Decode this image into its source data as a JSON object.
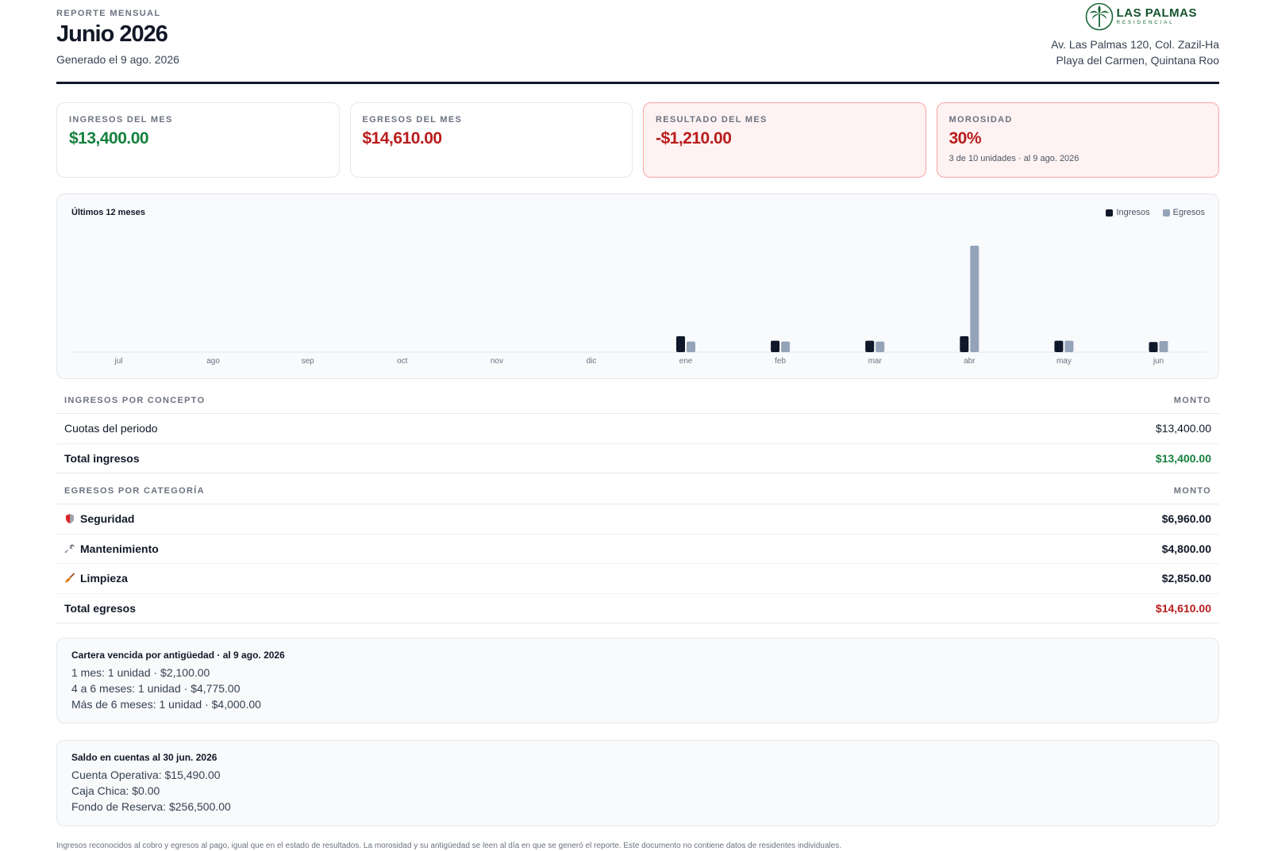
{
  "header": {
    "kicker": "REPORTE MENSUAL",
    "title": "Junio 2026",
    "subtitle": "Generado el 9 ago. 2026",
    "brand_name": "LAS PALMAS",
    "brand_sub": "RESIDENCIAL",
    "address_line1": "Av. Las Palmas 120, Col. Zazil-Ha",
    "address_line2": "Playa del Carmen, Quintana Roo"
  },
  "kpis": [
    {
      "label": "INGRESOS DEL MES",
      "value": "$13,400.00",
      "tone": "green"
    },
    {
      "label": "EGRESOS DEL MES",
      "value": "$14,610.00",
      "tone": "red"
    },
    {
      "label": "RESULTADO DEL MES",
      "value": "-$1,210.00",
      "tone": "red"
    },
    {
      "label": "MOROSIDAD",
      "value": "30%",
      "tone": "red",
      "note": "3 de 10 unidades · al 9 ago. 2026"
    }
  ],
  "chart": {
    "title": "Últimos 12 meses",
    "legend_income": "Ingresos",
    "legend_expense": "Egresos",
    "colors": {
      "income": "#0f172a",
      "expense": "#94a3b8"
    }
  },
  "chart_data": {
    "type": "bar",
    "title": "Últimos 12 meses",
    "categories": [
      "jul",
      "ago",
      "sep",
      "oct",
      "nov",
      "dic",
      "ene",
      "feb",
      "mar",
      "abr",
      "may",
      "jun"
    ],
    "series": [
      {
        "name": "Ingresos",
        "values": [
          0,
          0,
          0,
          0,
          0,
          0,
          21000,
          15000,
          15000,
          21000,
          15000,
          13400
        ]
      },
      {
        "name": "Egresos",
        "values": [
          0,
          0,
          0,
          0,
          0,
          0,
          14000,
          14000,
          14000,
          140000,
          15000,
          14610
        ]
      }
    ],
    "ylim": [
      0,
      145000
    ],
    "grid": false,
    "legend": "top-right"
  },
  "income_table": {
    "header_label": "INGRESOS POR CONCEPTO",
    "header_amount": "MONTO",
    "rows": [
      {
        "label": "Cuotas del periodo",
        "amount": "$13,400.00"
      }
    ],
    "total_label": "Total ingresos",
    "total_amount": "$13,400.00"
  },
  "expense_table": {
    "header_label": "EGRESOS POR CATEGORÍA",
    "header_amount": "MONTO",
    "rows": [
      {
        "label": "Seguridad",
        "amount": "$6,960.00",
        "icon": "shield-icon"
      },
      {
        "label": "Mantenimiento",
        "amount": "$4,800.00",
        "icon": "wrench-icon"
      },
      {
        "label": "Limpieza",
        "amount": "$2,850.00",
        "icon": "broom-icon"
      }
    ],
    "total_label": "Total egresos",
    "total_amount": "$14,610.00"
  },
  "aging": {
    "title": "Cartera vencida por antigüedad · al 9 ago. 2026",
    "lines": [
      "1 mes: 1 unidad · $2,100.00",
      "4 a 6 meses: 1 unidad · $4,775.00",
      "Más de 6 meses: 1 unidad · $4,000.00"
    ]
  },
  "balances": {
    "title": "Saldo en cuentas al 30 jun. 2026",
    "lines": [
      "Cuenta Operativa: $15,490.00",
      "Caja Chica: $0.00",
      "Fondo de Reserva: $256,500.00"
    ]
  },
  "footnote": "Ingresos reconocidos al cobro y egresos al pago, igual que en el estado de resultados. La morosidad y su antigüedad se leen al día en que se generó el reporte. Este documento no contiene datos de residentes individuales."
}
